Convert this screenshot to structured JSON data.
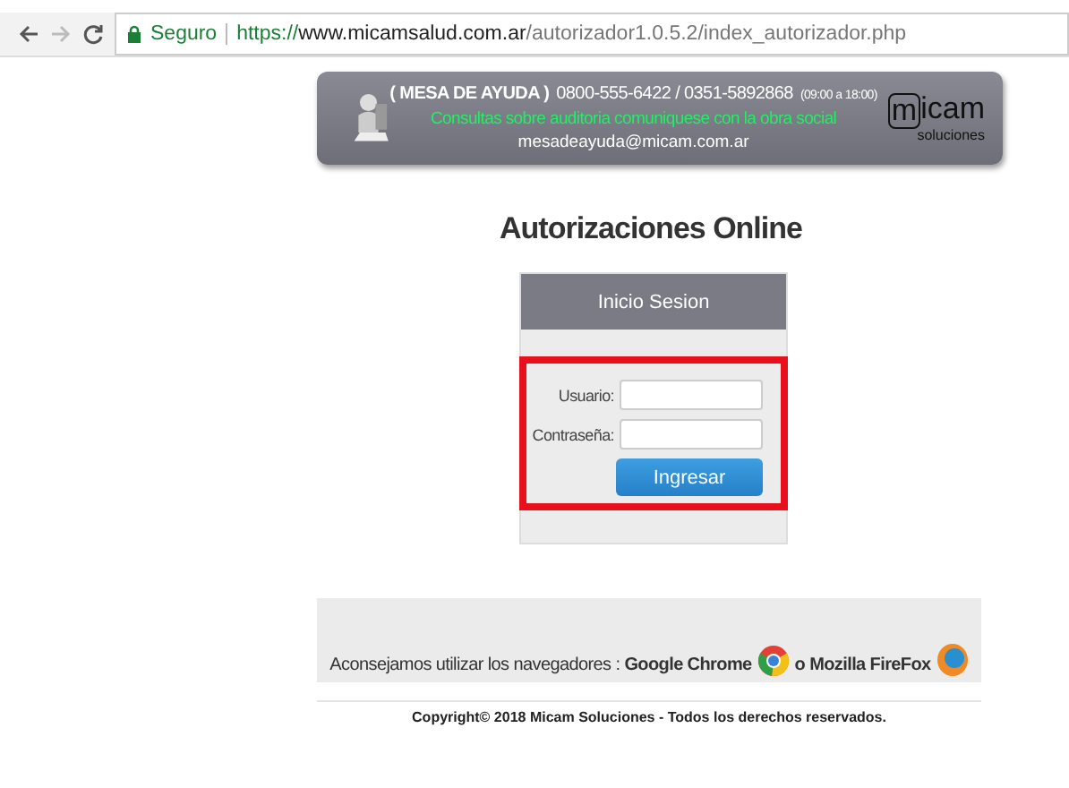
{
  "browser": {
    "security_label": "Seguro",
    "url_scheme": "https://",
    "url_host": "www.micamsalud.com.ar",
    "url_path": "/autorizador1.0.5.2/index_autorizador.php"
  },
  "banner": {
    "help_title": "( MESA DE AYUDA )",
    "phones": "0800-555-6422 / 0351-5892868",
    "hours": "(09:00 a 18:00)",
    "notice": "Consultas sobre auditoria comuniquese con la obra social",
    "email": "mesadeayuda@micam.com.ar",
    "logo_boxed": "m",
    "logo_rest": "icam",
    "logo_sub": "soluciones"
  },
  "title": "Autorizaciones Online",
  "login": {
    "header": "Inicio Sesion",
    "highlighted": true,
    "fields": [
      {
        "label": "Usuario:"
      },
      {
        "label": "Contraseña:"
      }
    ],
    "submit": "Ingresar"
  },
  "footer": {
    "advice": "Aconsejamos utilizar los navegadores : **Google Chrome**",
    "alternative": "o Mozilla FireFox",
    "copyright": "Copyright© 2018 Micam Soluciones - Todos los derechos reservados."
  }
}
